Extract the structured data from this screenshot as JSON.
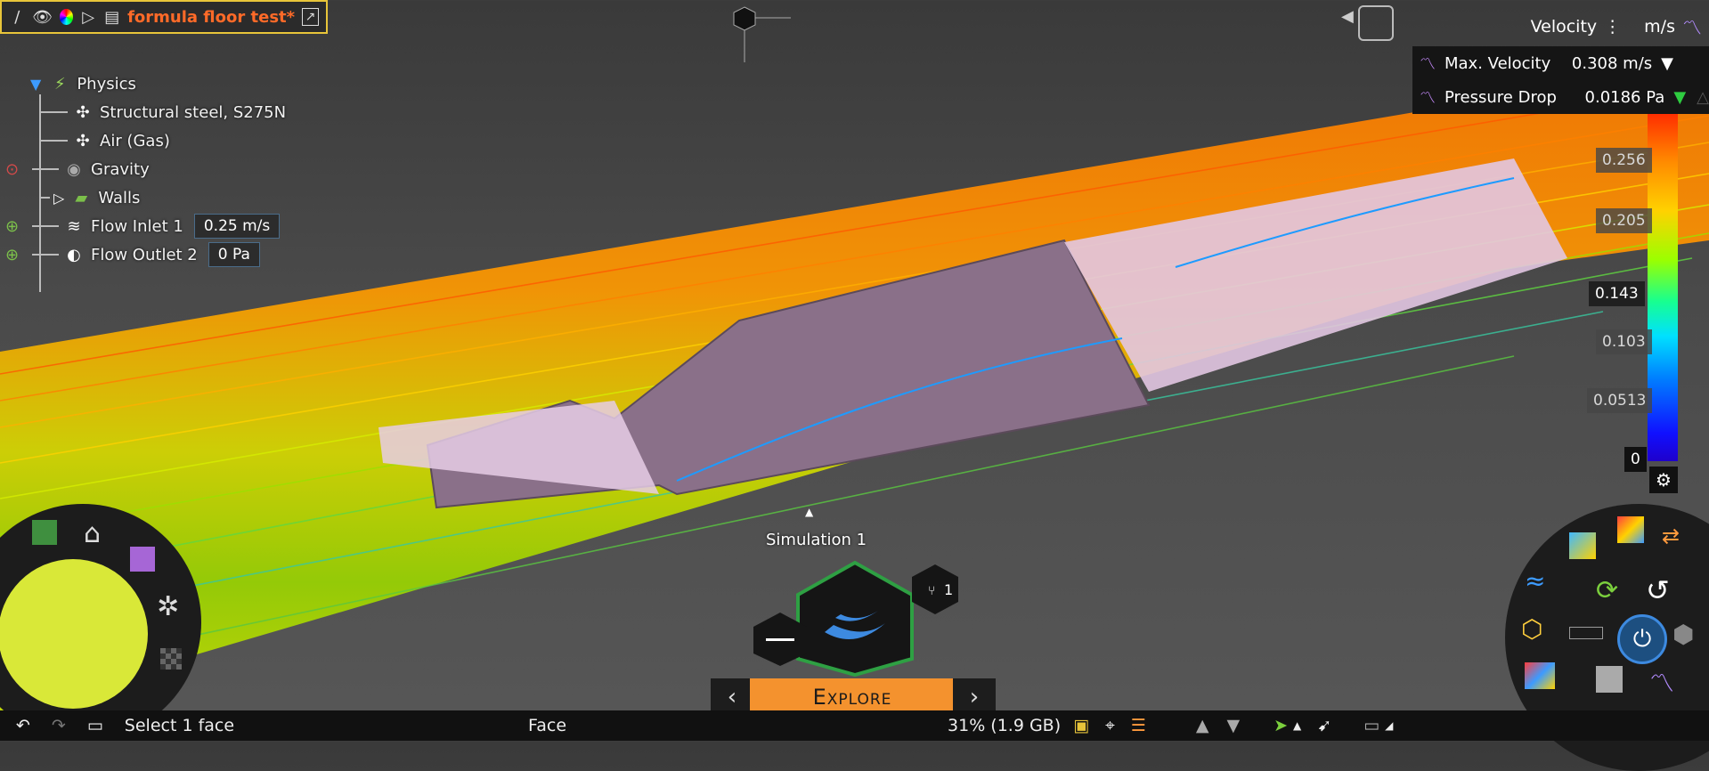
{
  "toolbar": {
    "doc_title": "formula floor test*"
  },
  "physics_tree": {
    "root_label": "Physics",
    "items": [
      {
        "label": "Structural steel, S275N"
      },
      {
        "label": "Air (Gas)"
      },
      {
        "label": "Gravity"
      },
      {
        "label": "Walls"
      },
      {
        "label": "Flow Inlet 1",
        "value": "0.25 m/s"
      },
      {
        "label": "Flow Outlet 2",
        "value": "0 Pa"
      }
    ]
  },
  "legend": {
    "quantity": "Velocity",
    "unit": "m/s",
    "ticks": [
      "0.256",
      "0.205",
      "0.143",
      "0.103",
      "0.0513",
      "0"
    ]
  },
  "kpis": [
    {
      "label": "Max. Velocity",
      "value": "0.308 m/s"
    },
    {
      "label": "Pressure Drop",
      "value": "0.0186 Pa"
    }
  ],
  "simulation": {
    "label": "Simulation 1",
    "branch_count": "1"
  },
  "mode": {
    "label": "Explore"
  },
  "statusbar": {
    "hint": "Select 1 face",
    "selection_type": "Face",
    "memory": "31% (1.9 GB)"
  },
  "colors": {
    "accent": "#f4922e",
    "title": "#ff6a28",
    "toolbar_border": "#e8c53a"
  }
}
